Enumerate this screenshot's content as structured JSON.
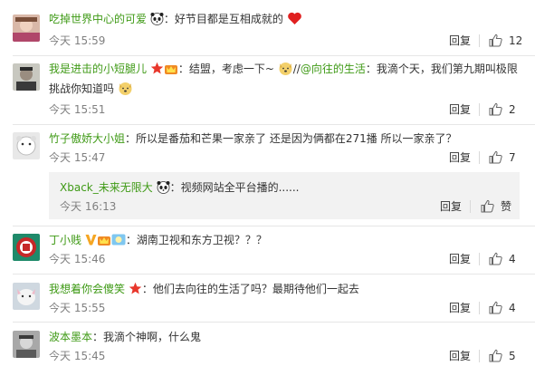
{
  "comments": [
    {
      "username": "吃掉世界中心的可爱",
      "badges": [
        "panda-emoji"
      ],
      "text": "：好节目都是互相成就的",
      "emoji_after": "heart-emoji",
      "time": "今天 15:59",
      "reply_label": "回复",
      "likes": "12"
    },
    {
      "username": "我是进击的小短腿儿",
      "badges": [
        "red-star-badge",
        "crown-badge"
      ],
      "text_parts": [
        "：结盟，考虑一下~",
        "//",
        "@向往的生活",
        "：我滴个天，我们第九期叫极限挑战你知道吗"
      ],
      "time": "今天 15:51",
      "reply_label": "回复",
      "likes": "2"
    },
    {
      "username": "竹子傲娇大小姐",
      "badges": [],
      "text": "：所以是番茄和芒果一家亲了 还是因为俩都在271播 所以一家亲了？",
      "time": "今天 15:47",
      "reply_label": "回复",
      "likes": "7"
    },
    {
      "username": "丁小贱",
      "badges": [
        "v-badge",
        "crown-badge",
        "level-badge"
      ],
      "text": "：湖南卫视和东方卫视？？？",
      "time": "今天 15:46",
      "reply_label": "回复",
      "likes": "4"
    },
    {
      "username": "我想着你会傻笑",
      "badges": [
        "red-star-badge"
      ],
      "text": "：他们去向往的生活了吗？最期待他们一起去",
      "time": "今天 15:55",
      "reply_label": "回复",
      "likes": "4"
    },
    {
      "username": "波本墨本",
      "badges": [],
      "text": "：我滴个神啊，什么鬼",
      "time": "今天 15:45",
      "reply_label": "回复",
      "likes": "5"
    }
  ],
  "sub_reply": {
    "username": "Xback_未来无限大",
    "badges": [
      "panda-emoji"
    ],
    "text": "：视频网站全平台播的......",
    "time": "今天 16:13",
    "reply_label": "回复",
    "like_label": "赞"
  },
  "colors": {
    "username": "#3f9a16",
    "time": "#808080",
    "sub_reply_bg": "#f2f2f2",
    "divider": "#e6e6e6"
  }
}
